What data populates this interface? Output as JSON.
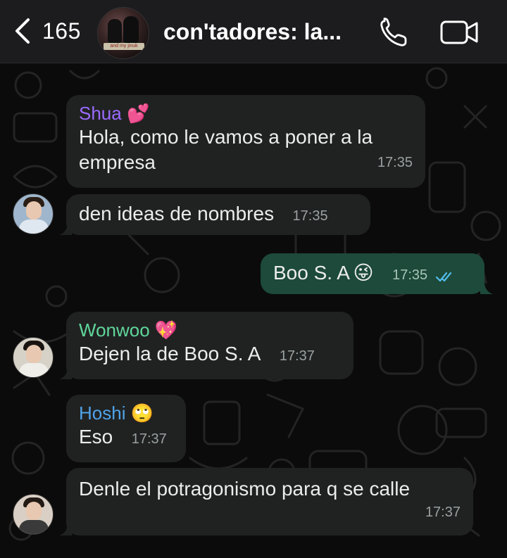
{
  "header": {
    "back_count": "165",
    "group_name": "con'tadores: la...",
    "group_avatar_caption": "and my jinuk"
  },
  "messages": [
    {
      "sender": "Shua",
      "sender_emoji": "💕",
      "sender_color": "#9b6bff",
      "text_line1": "Hola, como le vamos a poner a la",
      "text_line2": "empresa",
      "time": "17:35"
    },
    {
      "text": "den ideas de nombres",
      "time": "17:35"
    },
    {
      "text": "Boo S. A",
      "emoji": "😜",
      "time": "17:35",
      "direction": "outgoing",
      "status": "read"
    },
    {
      "sender": "Wonwoo",
      "sender_emoji": "💖",
      "sender_color": "#5fd79b",
      "text": "Dejen la de Boo S. A",
      "time": "17:37"
    },
    {
      "sender": "Hoshi",
      "sender_emoji": "🙄",
      "sender_color": "#4fa3e8",
      "text": "Eso",
      "time": "17:37"
    },
    {
      "text": "Denle el potragonismo para q se calle",
      "time": "17:37"
    }
  ],
  "colors": {
    "incoming_bubble": "#202222",
    "outgoing_bubble": "#1d4a3a",
    "read_ticks": "#53bdeb",
    "header_bg": "#1c1c1e"
  }
}
